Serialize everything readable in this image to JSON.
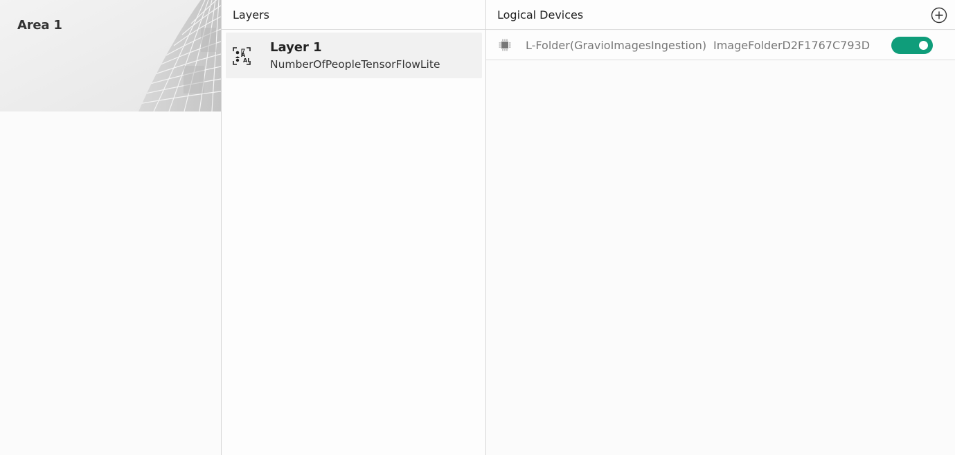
{
  "area": {
    "title": "Area 1"
  },
  "layers": {
    "header": "Layers",
    "items": [
      {
        "name": "Layer 1",
        "type": "NumberOfPeopleTensorFlowLite",
        "icon": "ai-detection-icon"
      }
    ]
  },
  "devices": {
    "header": "Logical Devices",
    "add_icon": "plus-circle-icon",
    "items": [
      {
        "icon": "chip-icon",
        "name": "L-Folder(GravioImagesIngestion)",
        "id": "ImageFolderD2F1767C793D",
        "enabled": true
      }
    ]
  },
  "colors": {
    "toggle_on": "#0f9d7a"
  }
}
